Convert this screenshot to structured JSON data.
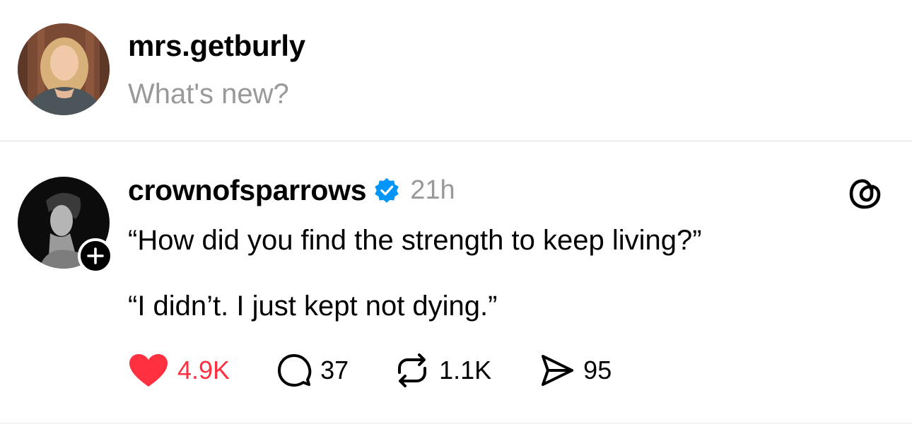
{
  "composer": {
    "username": "mrs.getburly",
    "placeholder": "What's new?",
    "avatar_icon": "user-avatar-woman"
  },
  "post": {
    "author": "crownofsparrows",
    "verified": true,
    "time": "21h",
    "lines": [
      "“How did you find the strength to keep living?”",
      "“I didn’t. I just kept not dying.”"
    ],
    "avatar_icon": "user-avatar-man-bw",
    "follow_icon": "plus-icon",
    "app_icon": "threads-logo-icon",
    "actions": {
      "likes": "4.9K",
      "replies": "37",
      "reposts": "1.1K",
      "shares": "95"
    }
  },
  "colors": {
    "like_red": "#ff3040",
    "verified_blue": "#0095f6",
    "muted_gray": "#999999"
  }
}
